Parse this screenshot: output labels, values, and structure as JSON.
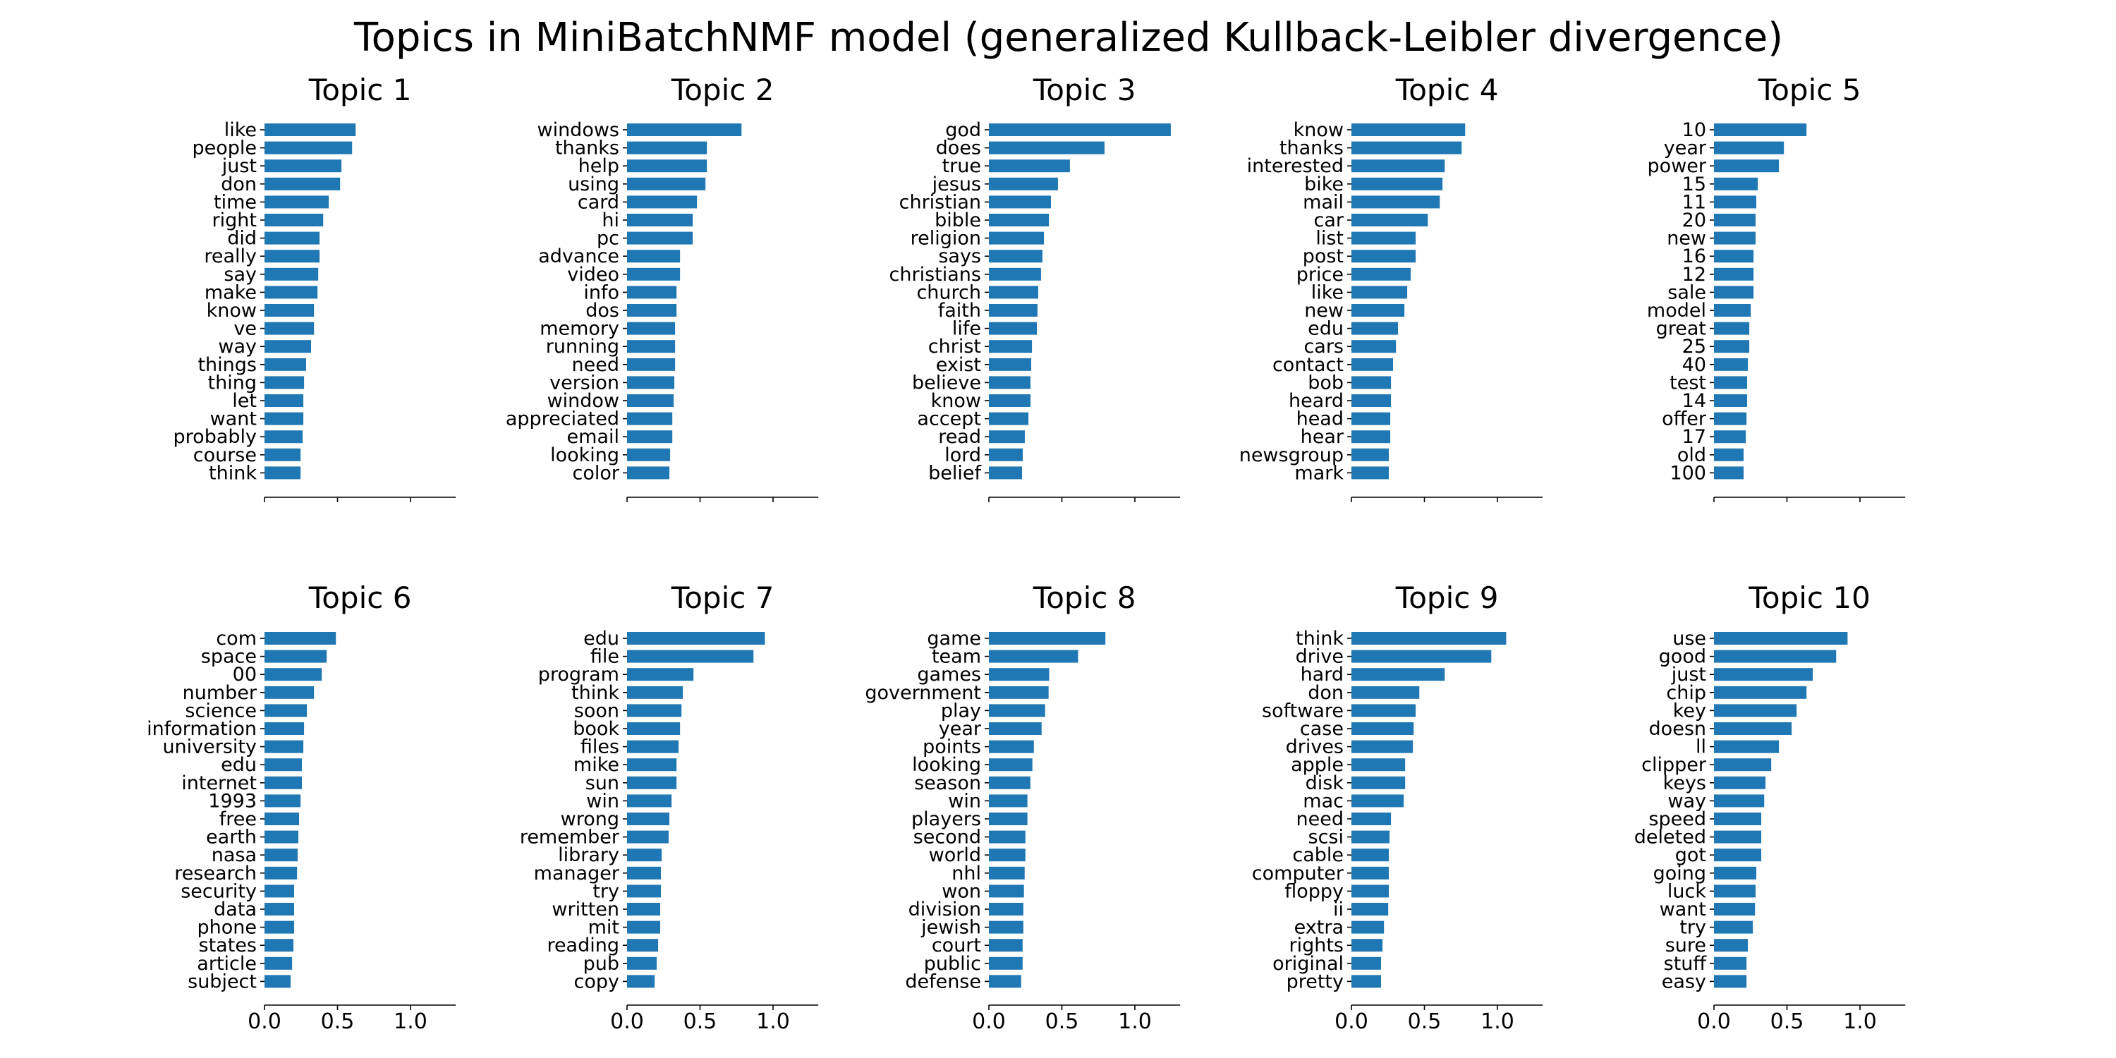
{
  "chart_data": {
    "type": "bar",
    "orientation": "horizontal",
    "title": "Topics in MiniBatchNMF model (generalized Kullback-Leibler divergence)",
    "layout": "2 rows x 5 columns",
    "bar_color": "#1f77b4",
    "xlim": [
      0,
      1.31
    ],
    "x_ticks": [
      "0.0",
      "0.5",
      "1.0"
    ],
    "x_tick_values": [
      0.0,
      0.5,
      1.0
    ],
    "x_tick_labels_shown_on": "bottom row only",
    "grid": false,
    "panels": [
      {
        "title": "Topic 1",
        "categories": [
          "like",
          "people",
          "just",
          "don",
          "time",
          "right",
          "did",
          "really",
          "say",
          "make",
          "know",
          "ve",
          "way",
          "things",
          "thing",
          "let",
          "want",
          "probably",
          "course",
          "think"
        ],
        "values": [
          0.624,
          0.6,
          0.527,
          0.518,
          0.44,
          0.402,
          0.377,
          0.377,
          0.368,
          0.363,
          0.339,
          0.339,
          0.319,
          0.285,
          0.271,
          0.266,
          0.266,
          0.261,
          0.247,
          0.247
        ]
      },
      {
        "title": "Topic 2",
        "categories": [
          "windows",
          "thanks",
          "help",
          "using",
          "card",
          "hi",
          "pc",
          "advance",
          "video",
          "info",
          "dos",
          "memory",
          "running",
          "need",
          "version",
          "window",
          "appreciated",
          "email",
          "looking",
          "color"
        ],
        "values": [
          0.784,
          0.547,
          0.547,
          0.537,
          0.479,
          0.45,
          0.45,
          0.363,
          0.363,
          0.339,
          0.339,
          0.329,
          0.329,
          0.329,
          0.324,
          0.319,
          0.31,
          0.31,
          0.295,
          0.29
        ]
      },
      {
        "title": "Topic 3",
        "categories": [
          "god",
          "does",
          "true",
          "jesus",
          "christian",
          "bible",
          "religion",
          "says",
          "christians",
          "church",
          "faith",
          "life",
          "christ",
          "exist",
          "believe",
          "know",
          "accept",
          "read",
          "lord",
          "belief"
        ],
        "values": [
          1.246,
          0.792,
          0.555,
          0.473,
          0.425,
          0.411,
          0.377,
          0.367,
          0.357,
          0.338,
          0.333,
          0.329,
          0.295,
          0.29,
          0.285,
          0.285,
          0.271,
          0.246,
          0.232,
          0.227
        ]
      },
      {
        "title": "Topic 4",
        "categories": [
          "know",
          "thanks",
          "interested",
          "bike",
          "mail",
          "car",
          "list",
          "post",
          "price",
          "like",
          "new",
          "edu",
          "cars",
          "contact",
          "bob",
          "heard",
          "head",
          "hear",
          "newsgroup",
          "mark"
        ],
        "values": [
          0.779,
          0.755,
          0.639,
          0.624,
          0.605,
          0.523,
          0.44,
          0.44,
          0.406,
          0.382,
          0.363,
          0.319,
          0.305,
          0.285,
          0.271,
          0.271,
          0.266,
          0.266,
          0.256,
          0.256
        ]
      },
      {
        "title": "Topic 5",
        "categories": [
          "10",
          "year",
          "power",
          "15",
          "11",
          "20",
          "new",
          "16",
          "12",
          "sale",
          "model",
          "great",
          "25",
          "40",
          "test",
          "14",
          "offer",
          "17",
          "old",
          "100"
        ],
        "values": [
          0.634,
          0.479,
          0.445,
          0.3,
          0.29,
          0.285,
          0.285,
          0.271,
          0.271,
          0.271,
          0.252,
          0.242,
          0.242,
          0.232,
          0.227,
          0.227,
          0.223,
          0.218,
          0.203,
          0.203
        ]
      },
      {
        "title": "Topic 6",
        "categories": [
          "com",
          "space",
          "00",
          "number",
          "science",
          "information",
          "university",
          "edu",
          "internet",
          "1993",
          "free",
          "earth",
          "nasa",
          "research",
          "security",
          "data",
          "phone",
          "states",
          "article",
          "subject"
        ],
        "values": [
          0.489,
          0.426,
          0.392,
          0.339,
          0.29,
          0.271,
          0.266,
          0.256,
          0.256,
          0.247,
          0.237,
          0.232,
          0.227,
          0.223,
          0.203,
          0.203,
          0.203,
          0.198,
          0.189,
          0.179
        ]
      },
      {
        "title": "Topic 7",
        "categories": [
          "edu",
          "file",
          "program",
          "think",
          "soon",
          "book",
          "files",
          "mike",
          "sun",
          "win",
          "wrong",
          "remember",
          "library",
          "manager",
          "try",
          "written",
          "mit",
          "reading",
          "pub",
          "copy"
        ],
        "values": [
          0.944,
          0.866,
          0.455,
          0.382,
          0.373,
          0.363,
          0.353,
          0.339,
          0.339,
          0.305,
          0.29,
          0.285,
          0.237,
          0.232,
          0.232,
          0.227,
          0.227,
          0.213,
          0.203,
          0.189
        ]
      },
      {
        "title": "Topic 8",
        "categories": [
          "game",
          "team",
          "games",
          "government",
          "play",
          "year",
          "points",
          "looking",
          "season",
          "win",
          "players",
          "second",
          "world",
          "nhl",
          "won",
          "division",
          "jewish",
          "court",
          "public",
          "defense"
        ],
        "values": [
          0.798,
          0.611,
          0.413,
          0.409,
          0.385,
          0.361,
          0.308,
          0.298,
          0.284,
          0.264,
          0.264,
          0.25,
          0.25,
          0.245,
          0.24,
          0.236,
          0.236,
          0.231,
          0.231,
          0.221
        ]
      },
      {
        "title": "Topic 9",
        "categories": [
          "think",
          "drive",
          "hard",
          "don",
          "software",
          "case",
          "drives",
          "apple",
          "disk",
          "mac",
          "need",
          "scsi",
          "cable",
          "computer",
          "floppy",
          "ii",
          "extra",
          "rights",
          "original",
          "pretty"
        ],
        "values": [
          1.06,
          0.958,
          0.639,
          0.465,
          0.44,
          0.426,
          0.421,
          0.368,
          0.368,
          0.358,
          0.271,
          0.261,
          0.256,
          0.256,
          0.256,
          0.252,
          0.223,
          0.213,
          0.203,
          0.203
        ]
      },
      {
        "title": "Topic 10",
        "categories": [
          "use",
          "good",
          "just",
          "chip",
          "key",
          "doesn",
          "ll",
          "clipper",
          "keys",
          "way",
          "speed",
          "deleted",
          "got",
          "going",
          "luck",
          "want",
          "try",
          "sure",
          "stuff",
          "easy"
        ],
        "values": [
          0.915,
          0.837,
          0.677,
          0.634,
          0.566,
          0.532,
          0.445,
          0.392,
          0.353,
          0.344,
          0.324,
          0.324,
          0.324,
          0.29,
          0.285,
          0.281,
          0.266,
          0.232,
          0.223,
          0.223
        ]
      }
    ]
  }
}
